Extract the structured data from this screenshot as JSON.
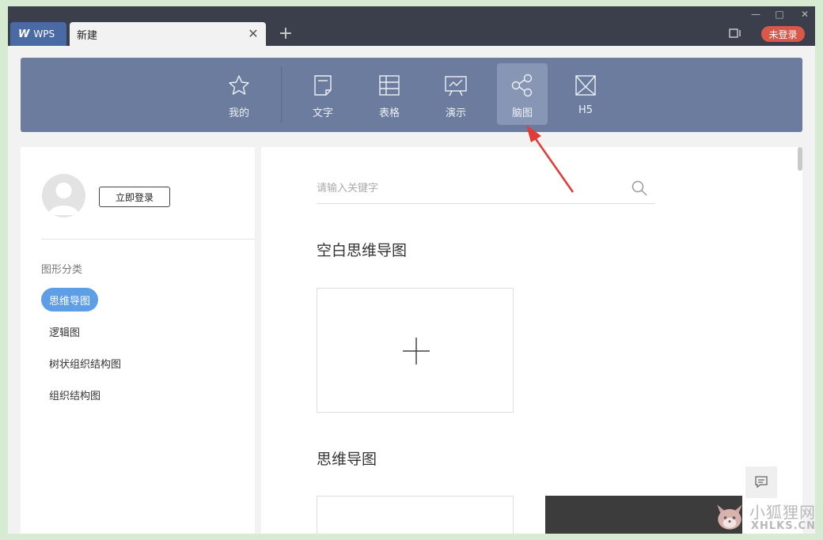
{
  "titlebar": {
    "app_tab": "WPS",
    "app_logo": "W",
    "doc_tab": "新建",
    "login_badge": "未登录",
    "close_icon": "close-icon",
    "add_icon": "plus-icon"
  },
  "toolbar": {
    "items": [
      {
        "label": "我的",
        "icon": "star-icon"
      },
      {
        "label": "文字",
        "icon": "document-icon"
      },
      {
        "label": "表格",
        "icon": "table-icon"
      },
      {
        "label": "演示",
        "icon": "presentation-icon"
      },
      {
        "label": "脑图",
        "icon": "mindmap-icon",
        "active": true
      },
      {
        "label": "H5",
        "icon": "h5-icon"
      }
    ]
  },
  "sidebar": {
    "login_button": "立即登录",
    "category_title": "图形分类",
    "categories": [
      {
        "label": "思维导图",
        "active": true
      },
      {
        "label": "逻辑图"
      },
      {
        "label": "树状组织结构图"
      },
      {
        "label": "组织结构图"
      }
    ]
  },
  "main": {
    "search_placeholder": "请输入关键字",
    "blank_section_title": "空白思维导图",
    "template_section_title": "思维导图"
  },
  "watermark": {
    "line1": "小狐狸网",
    "line2": "XHLKS.CN"
  },
  "colors": {
    "toolbar_bg": "#6b7c9e",
    "active_category": "#5d9ee6",
    "login_badge": "#d9584a",
    "annotation_arrow": "#e53935"
  }
}
